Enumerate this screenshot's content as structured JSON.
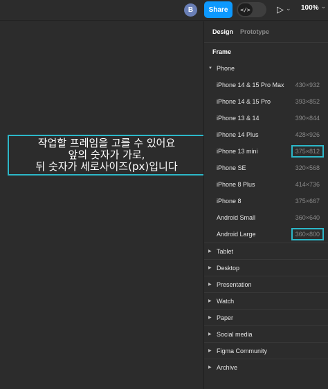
{
  "toolbar": {
    "avatar_initial": "B",
    "share_label": "Share",
    "devmode_glyph": "</>",
    "play_glyph": "▷",
    "play_caret": "⌄",
    "zoom": "100%",
    "zoom_caret": "⌄",
    "brand_color": "#0d99ff"
  },
  "canvas": {
    "callout_lines": [
      "작업할 프레임을 고를 수 있어요",
      "앞의 숫자가 가로,",
      "뒤 숫자가 세로사이즈(px)입니다"
    ],
    "callout_color": "#2cb8c9"
  },
  "panel": {
    "tabs": [
      "Design",
      "Prototype"
    ],
    "section_title": "Frame",
    "expanded_group": "Phone",
    "phone_items": [
      {
        "name": "iPhone 14 & 15 Pro Max",
        "size": "430×932",
        "highlight": false
      },
      {
        "name": "iPhone 14 & 15 Pro",
        "size": "393×852",
        "highlight": false
      },
      {
        "name": "iPhone 13 & 14",
        "size": "390×844",
        "highlight": false
      },
      {
        "name": "iPhone 14 Plus",
        "size": "428×926",
        "highlight": false
      },
      {
        "name": "iPhone 13 mini",
        "size": "375×812",
        "highlight": true
      },
      {
        "name": "iPhone SE",
        "size": "320×568",
        "highlight": false
      },
      {
        "name": "iPhone 8 Plus",
        "size": "414×736",
        "highlight": false
      },
      {
        "name": "iPhone 8",
        "size": "375×667",
        "highlight": false
      },
      {
        "name": "Android Small",
        "size": "360×640",
        "highlight": false
      },
      {
        "name": "Android Large",
        "size": "360×800",
        "highlight": true
      }
    ],
    "collapsed_groups": [
      "Tablet",
      "Desktop",
      "Presentation",
      "Watch",
      "Paper",
      "Social media",
      "Figma Community",
      "Archive"
    ],
    "caret_expanded": "▼",
    "caret_collapsed": "▶"
  }
}
